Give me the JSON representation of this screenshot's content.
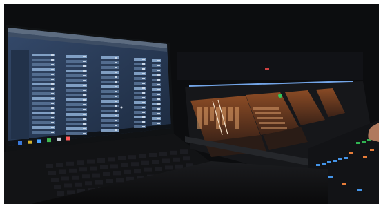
{
  "photo": {
    "subject": "laptop-and-mixing-console",
    "colors": {
      "background": "#0b0c0e",
      "laptop_screen": "#2b3d57",
      "console_screen": "#6b3a22",
      "led_green": "#34c759",
      "led_blue": "#4aa3ff",
      "led_orange": "#ff8a3d"
    }
  }
}
